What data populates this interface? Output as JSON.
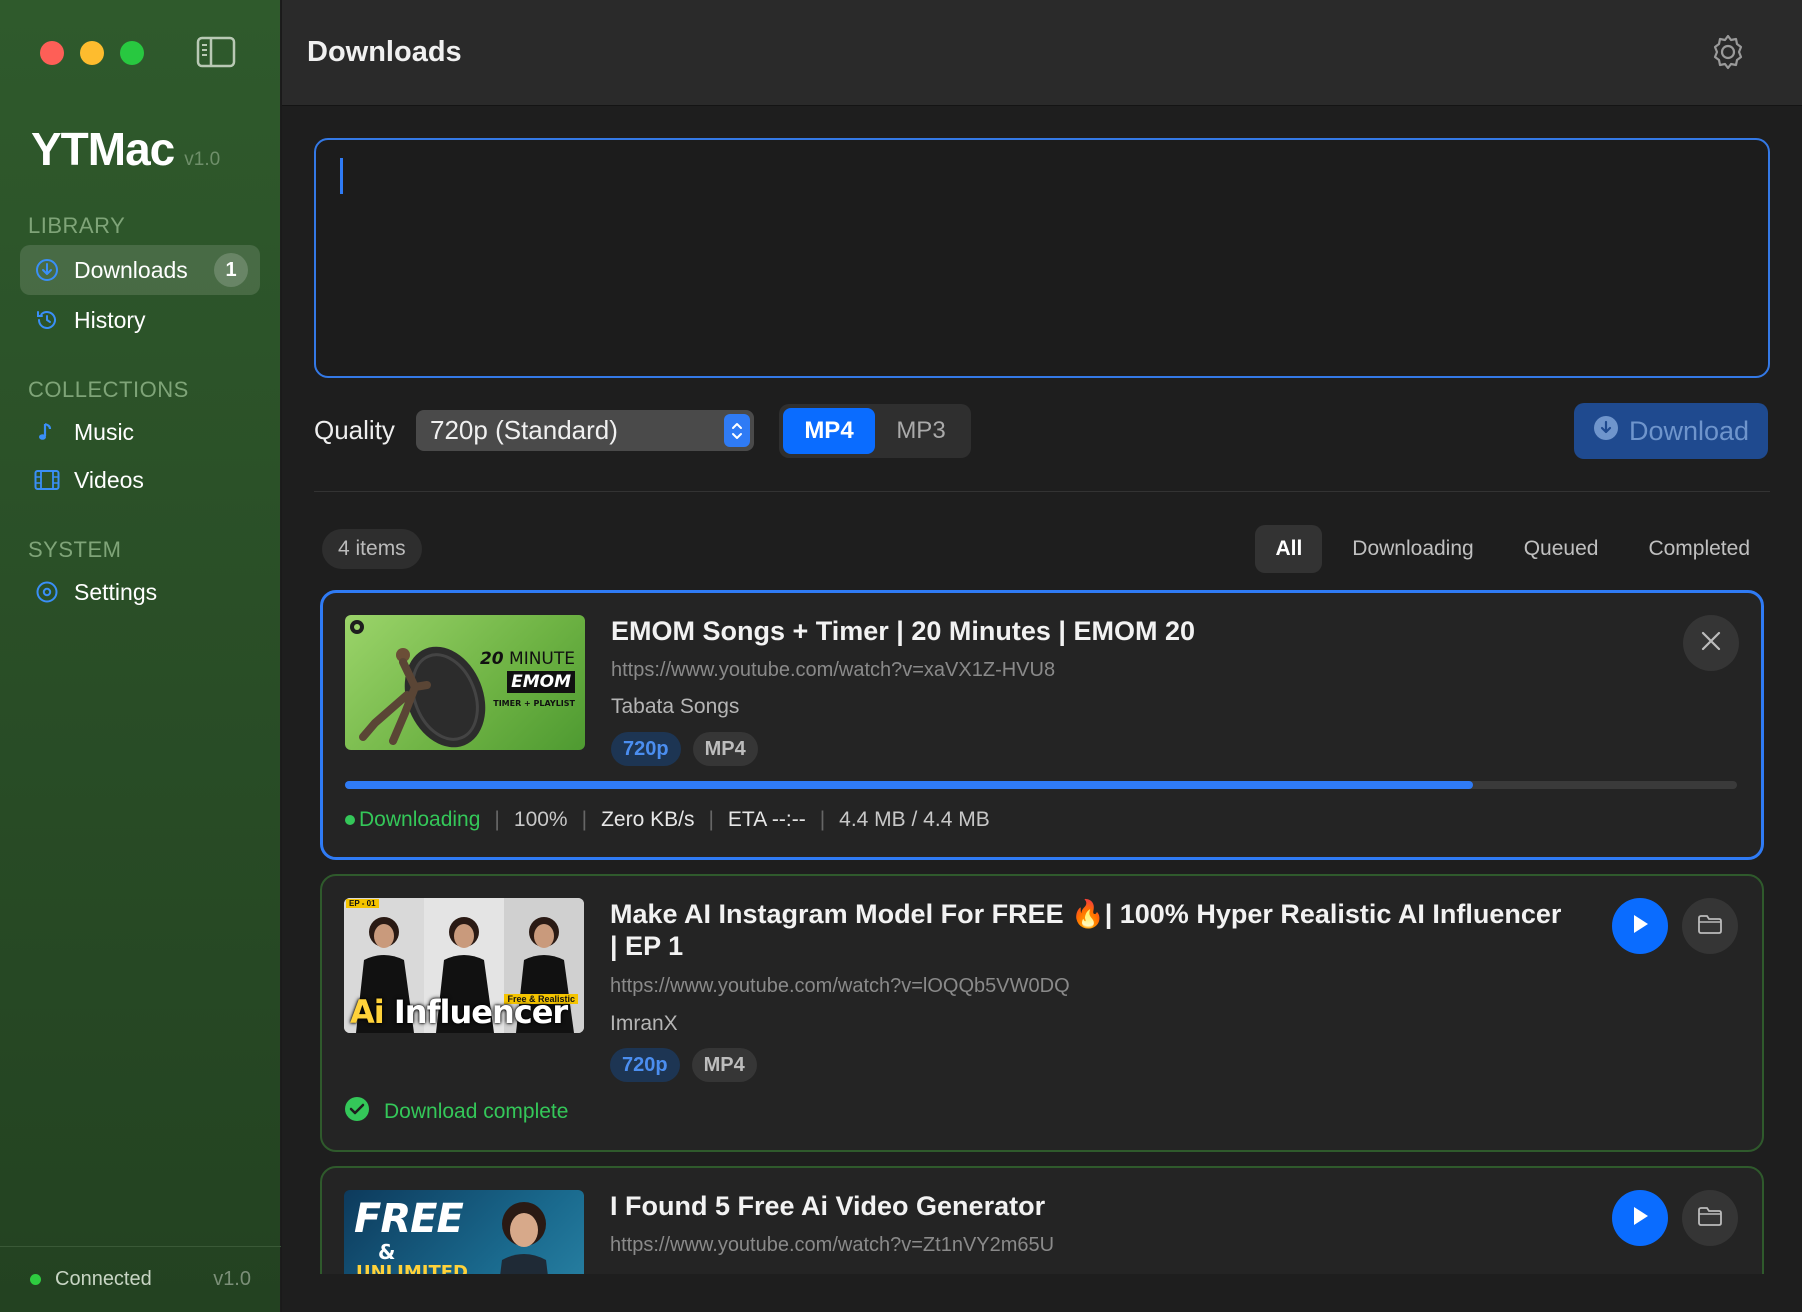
{
  "app": {
    "name": "YTMac",
    "version": "v1.0"
  },
  "sidebar": {
    "sections": {
      "library": "LIBRARY",
      "collections": "COLLECTIONS",
      "system": "SYSTEM"
    },
    "items": [
      {
        "label": "Downloads",
        "icon": "download-circle-icon",
        "badge": "1"
      },
      {
        "label": "History",
        "icon": "clock-icon"
      },
      {
        "label": "Music",
        "icon": "music-note-icon"
      },
      {
        "label": "Videos",
        "icon": "film-icon"
      },
      {
        "label": "Settings",
        "icon": "gear-icon"
      }
    ],
    "footer": {
      "status": "Connected",
      "version": "v1.0"
    }
  },
  "header": {
    "title": "Downloads"
  },
  "input": {
    "value": ""
  },
  "controls": {
    "quality_label": "Quality",
    "quality_value": "720p (Standard)",
    "formats": [
      "MP4",
      "MP3"
    ],
    "active_format": "MP4",
    "download_label": "Download"
  },
  "list": {
    "count": "4 items",
    "filters": [
      "All",
      "Downloading",
      "Queued",
      "Completed"
    ],
    "active_filter": "All",
    "items": [
      {
        "title": "EMOM Songs + Timer  | 20 Minutes | EMOM 20",
        "url": "https://www.youtube.com/watch?v=xaVX1Z-HVU8",
        "channel": "Tabata Songs",
        "quality": "720p",
        "format": "MP4",
        "thumb_text": {
          "line1a": "20",
          "line1b": " MINUTE",
          "line2": "EMOM",
          "line3": "TIMER + PLAYLIST"
        },
        "progress": 0.81,
        "status": "Downloading",
        "percent": "100%",
        "speed": "Zero KB/s",
        "eta": "ETA --:--",
        "size": "4.4 MB / 4.4 MB"
      },
      {
        "title_line1": "Make AI Instagram Model For FREE 🔥| 100% Hyper Realistic AI Influencer",
        "title_line2": "| EP 1",
        "url": "https://www.youtube.com/watch?v=lOQQb5VW0DQ",
        "channel": "ImranX",
        "quality": "720p",
        "format": "MP4",
        "thumb_text": {
          "ep": "EP - 01",
          "tag": "Free & Realistic",
          "ai": "Ai",
          "rest": " Influencer"
        },
        "status": "Download complete"
      },
      {
        "title": "I Found 5 Free Ai Video Generator",
        "url": "https://www.youtube.com/watch?v=Zt1nVY2m65U",
        "thumb_text": {
          "free": "FREE",
          "amp": "&",
          "unlimited": "UNLIMITED"
        }
      }
    ]
  },
  "colors": {
    "accent": "#0a6cff",
    "sidebar": "#2f5a2c",
    "success": "#34c759",
    "close": "#fe5f57",
    "minimize": "#febc2e",
    "zoom": "#28c840"
  }
}
